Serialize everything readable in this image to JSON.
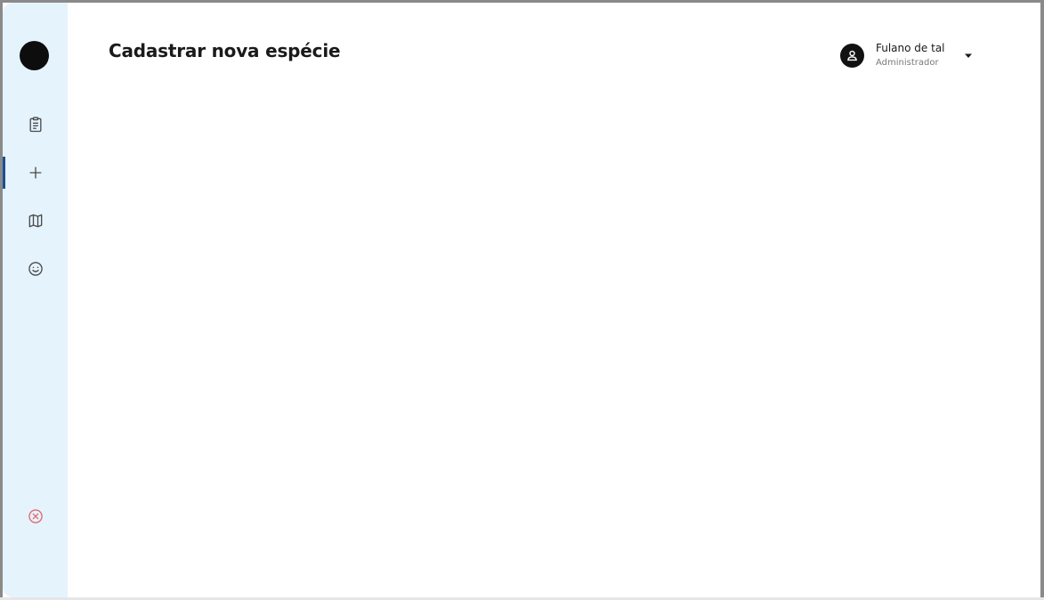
{
  "page": {
    "title": "Cadastrar nova espécie"
  },
  "sidebar": {
    "items": [
      {
        "name": "documents",
        "icon": "clipboard-icon",
        "active": false
      },
      {
        "name": "add",
        "icon": "plus-icon",
        "active": true
      },
      {
        "name": "map",
        "icon": "map-icon",
        "active": false
      },
      {
        "name": "face",
        "icon": "smiley-icon",
        "active": false
      }
    ],
    "exit_icon": "close-circle-icon"
  },
  "user": {
    "name": "Fulano de tal",
    "role": "Administrador",
    "avatar_icon": "user-icon",
    "menu_icon": "caret-down-icon"
  },
  "colors": {
    "sidebar_bg": "#e5f3fd",
    "active_indicator": "#1d4f91",
    "exit_icon": "#e06a6a",
    "nav_icon": "#4a4a4a"
  }
}
